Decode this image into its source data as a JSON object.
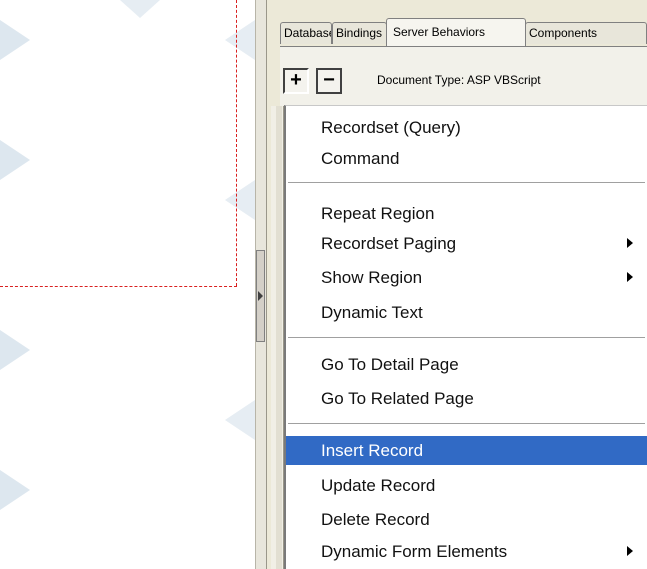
{
  "panel": {
    "tabs": [
      {
        "label": "Databases"
      },
      {
        "label": "Bindings"
      },
      {
        "label": "Server Behaviors"
      },
      {
        "label": "Components"
      }
    ],
    "document_type": "Document Type: ASP VBScript",
    "add_label": "+",
    "remove_label": "−"
  },
  "menu": {
    "items": [
      {
        "label": "Recordset (Query)"
      },
      {
        "label": "Command"
      },
      {
        "label": "Repeat Region"
      },
      {
        "label": "Recordset Paging"
      },
      {
        "label": "Show Region"
      },
      {
        "label": "Dynamic Text"
      },
      {
        "label": "Go To Detail Page"
      },
      {
        "label": "Go To Related Page"
      },
      {
        "label": "Insert Record"
      },
      {
        "label": "Update Record"
      },
      {
        "label": "Delete Record"
      },
      {
        "label": "Dynamic Form Elements"
      }
    ],
    "selected": "Insert Record"
  },
  "colors": {
    "selection": "#316ac5",
    "dashed_region": "#d92020"
  }
}
